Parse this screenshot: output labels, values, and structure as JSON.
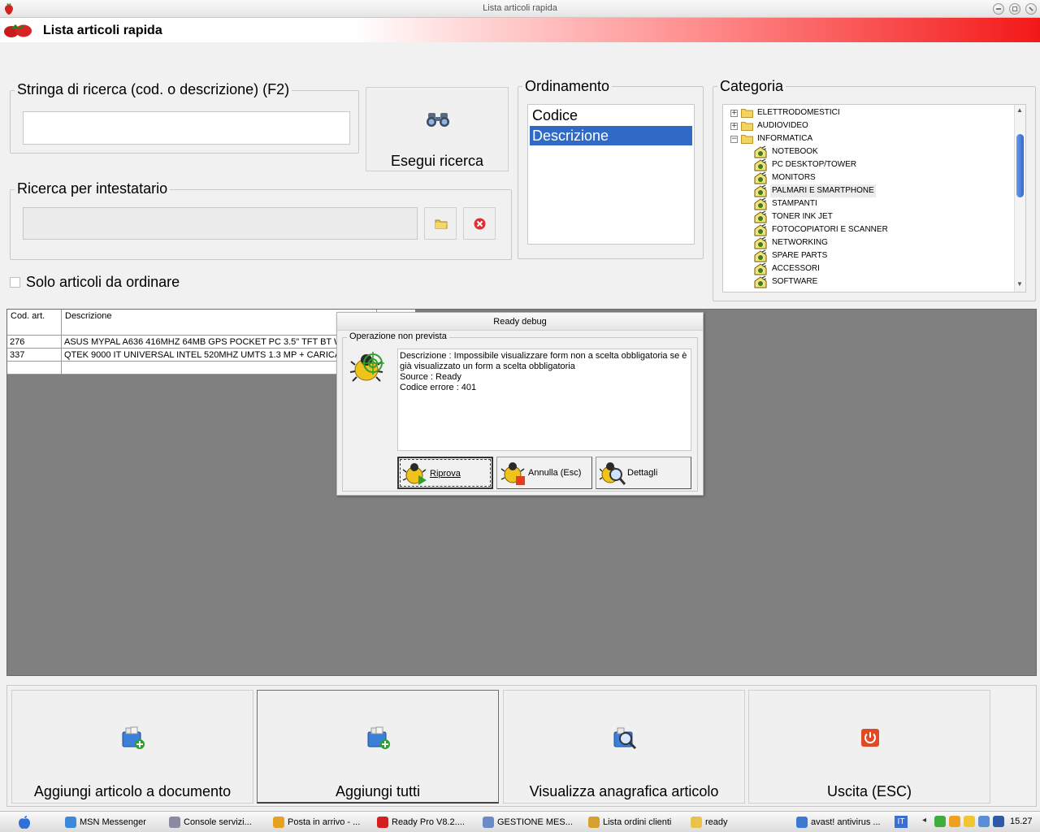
{
  "window": {
    "title": "Lista articoli rapida",
    "header_title": "Lista articoli rapida"
  },
  "search": {
    "legend": "Stringa di ricerca (cod. o descrizione) (F2)",
    "value": "",
    "button_label": "Esegui ricerca"
  },
  "holder": {
    "legend": "Ricerca per intestatario",
    "value": ""
  },
  "ordering": {
    "legend": "Ordinamento",
    "options": [
      "Codice",
      "Descrizione"
    ],
    "selected": "Descrizione"
  },
  "category": {
    "legend": "Categoria",
    "items": [
      {
        "label": "ELETTRODOMESTICI",
        "level": 0,
        "expander": "+"
      },
      {
        "label": "AUDIOVIDEO",
        "level": 0,
        "expander": "+"
      },
      {
        "label": "INFORMATICA",
        "level": 0,
        "expander": "−"
      },
      {
        "label": "NOTEBOOK",
        "level": 1
      },
      {
        "label": "PC DESKTOP/TOWER",
        "level": 1
      },
      {
        "label": "MONITORS",
        "level": 1
      },
      {
        "label": "PALMARI E SMARTPHONE",
        "level": 1,
        "highlighted": true
      },
      {
        "label": "STAMPANTI",
        "level": 1
      },
      {
        "label": "TONER INK JET",
        "level": 1
      },
      {
        "label": "FOTOCOPIATORI E SCANNER",
        "level": 1
      },
      {
        "label": "NETWORKING",
        "level": 1
      },
      {
        "label": "SPARE PARTS",
        "level": 1
      },
      {
        "label": "ACCESSORI",
        "level": 1
      },
      {
        "label": "SOFTWARE",
        "level": 1
      }
    ]
  },
  "only_to_order": {
    "label": "Solo articoli da ordinare",
    "checked": false
  },
  "grid": {
    "columns": [
      "Cod. art.",
      "Descrizione"
    ],
    "rows": [
      {
        "code": "276",
        "description": "ASUS MYPAL A636 416MHZ 64MB GPS POCKET PC 3.5\" TFT BT W"
      },
      {
        "code": "337",
        "description": "QTEK 9000 IT UNIVERSAL INTEL  520MHZ UMTS 1.3 MP + CARICA"
      }
    ]
  },
  "dialog": {
    "title": "Ready debug",
    "group_label": "Operazione non prevista",
    "message": [
      "Descrizione : Impossibile visualizzare form non a scelta obbligatoria se è già visualizzato un form a scelta obbligatoria",
      "Source : Ready",
      "Codice errore : 401"
    ],
    "buttons": {
      "retry": "Riprova",
      "cancel": "Annulla (Esc)",
      "details": "Dettagli"
    }
  },
  "actions": {
    "add_to_document": "Aggiungi articolo a documento",
    "add_all": "Aggiungi tutti",
    "view_item": "Visualizza anagrafica articolo",
    "exit": "Uscita (ESC)"
  },
  "taskbar": {
    "items": [
      "MSN Messenger",
      "Console servizi...",
      "Posta in arrivo - ...",
      "Ready Pro V8.2....",
      "GESTIONE MES...",
      "Lista ordini clienti",
      "ready",
      "avast! antivirus ..."
    ],
    "language": "IT",
    "clock": "15.27"
  },
  "colors": {
    "selection": "#316ac5",
    "header_gradient_end": "#f31818",
    "grid_background": "#808080"
  }
}
